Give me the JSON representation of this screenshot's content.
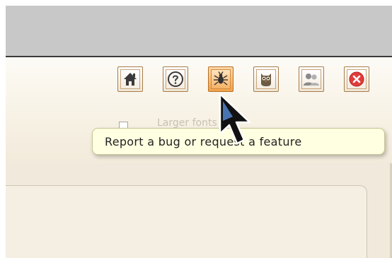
{
  "toolbar": {
    "buttons": [
      {
        "icon": "home-icon",
        "name": "home-button"
      },
      {
        "icon": "help-icon",
        "name": "help-button"
      },
      {
        "icon": "bug-icon",
        "name": "report-bug-button",
        "active": true
      },
      {
        "icon": "owl-icon",
        "name": "owl-button"
      },
      {
        "icon": "users-icon",
        "name": "users-button"
      },
      {
        "icon": "close-icon",
        "name": "close-button"
      }
    ]
  },
  "options": {
    "checkbox_label": "Larger fonts"
  },
  "tooltip": {
    "text": "Report a bug or request a feature"
  },
  "colors": {
    "tooltip_bg": "#ffffe1",
    "active_button": "#f2a24b",
    "close_red": "#e23b3b"
  }
}
